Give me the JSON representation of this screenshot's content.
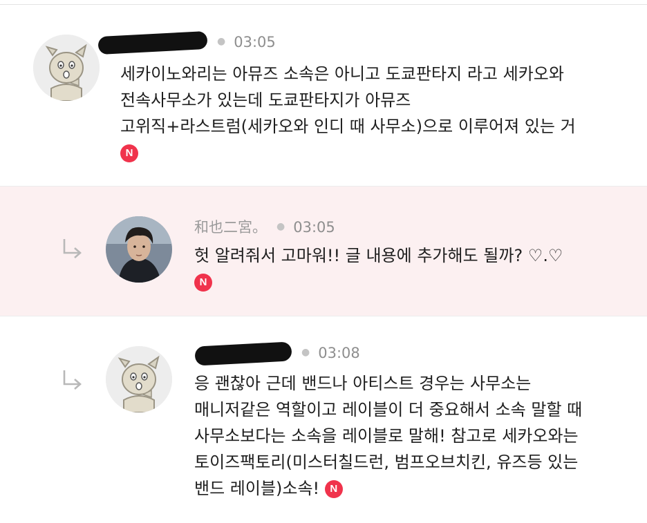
{
  "comments": [
    {
      "author": "",
      "author_redacted": true,
      "time": "03:05",
      "lines": [
        "세카이노와리는 아뮤즈 소속은 아니고 도쿄판타지 라고 세카오와",
        "전속사무소가 있는데 도쿄판타지가 아뮤즈",
        "고위직+라스트럼(세카오와 인디 때 사무소)으로 이루어져 있는 거"
      ],
      "badge": "N",
      "is_reply": false
    },
    {
      "author": "和也二宮。",
      "author_redacted": false,
      "time": "03:05",
      "lines": [
        "헛 알려줘서 고마워!! 글 내용에 추가해도 될까? ♡.♡"
      ],
      "badge": "N",
      "is_reply": true
    },
    {
      "author": "",
      "author_redacted": true,
      "time": "03:08",
      "lines": [
        "응 괜찮아 근데 밴드나 아티스트 경우는 사무소는",
        "매니저같은 역할이고 레이블이 더 중요해서 소속 말할 때",
        "사무소보다는 소속을 레이블로 말해! 참고로 세카오와는",
        "토이즈팩토리(미스터칠드런, 범프오브치킨, 유즈등 있는",
        "밴드 레이블)소속!"
      ],
      "badge": "N",
      "is_reply": true
    }
  ],
  "icons": {
    "reply": "reply-arrow-icon",
    "new_badge": "new-badge-icon",
    "default_avatar": "dog-avatar-icon"
  },
  "colors": {
    "highlight_bg": "#fcf0f1",
    "badge_red": "#f0334c",
    "meta_gray": "#9a9a9a"
  }
}
